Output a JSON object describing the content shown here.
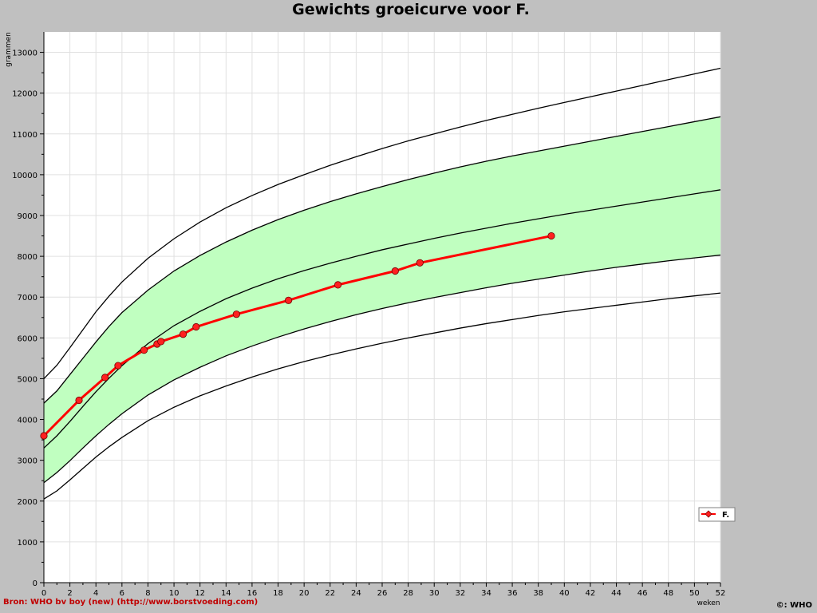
{
  "chart_data": {
    "type": "line",
    "title": "Gewichts groeicurve voor F.",
    "xlabel": "weken",
    "ylabel": "grammen",
    "xlim": [
      0,
      52
    ],
    "ylim": [
      0,
      13500
    ],
    "x_ticks": [
      0,
      2,
      4,
      6,
      8,
      10,
      12,
      14,
      16,
      18,
      20,
      22,
      24,
      26,
      28,
      30,
      32,
      34,
      36,
      38,
      40,
      42,
      44,
      46,
      48,
      50,
      52
    ],
    "y_ticks": [
      0,
      1000,
      2000,
      3000,
      4000,
      5000,
      6000,
      7000,
      8000,
      9000,
      10000,
      11000,
      12000,
      13000
    ],
    "grid": true,
    "reference_x": [
      0,
      1,
      2,
      3,
      4,
      5,
      6,
      8,
      10,
      12,
      14,
      16,
      18,
      20,
      22,
      24,
      26,
      28,
      30,
      32,
      34,
      36,
      38,
      40,
      42,
      44,
      46,
      48,
      50,
      52
    ],
    "reference_curves": [
      {
        "values": [
          2050,
          2250,
          2520,
          2800,
          3080,
          3330,
          3560,
          3970,
          4300,
          4580,
          4820,
          5040,
          5240,
          5420,
          5580,
          5730,
          5870,
          6000,
          6120,
          6240,
          6350,
          6450,
          6550,
          6640,
          6720,
          6800,
          6880,
          6960,
          7030,
          7100
        ]
      },
      {
        "values": [
          2450,
          2700,
          2990,
          3300,
          3600,
          3880,
          4140,
          4600,
          4970,
          5280,
          5560,
          5800,
          6020,
          6220,
          6400,
          6570,
          6720,
          6860,
          6990,
          7110,
          7230,
          7340,
          7440,
          7540,
          7640,
          7730,
          7810,
          7890,
          7960,
          8030
        ]
      },
      {
        "values": [
          3300,
          3600,
          3950,
          4320,
          4680,
          5010,
          5320,
          5860,
          6300,
          6650,
          6960,
          7220,
          7450,
          7650,
          7830,
          8000,
          8160,
          8300,
          8440,
          8570,
          8690,
          8810,
          8920,
          9030,
          9130,
          9230,
          9330,
          9430,
          9530,
          9630
        ]
      },
      {
        "values": [
          4400,
          4700,
          5100,
          5500,
          5900,
          6280,
          6620,
          7170,
          7640,
          8020,
          8350,
          8640,
          8900,
          9130,
          9340,
          9530,
          9710,
          9880,
          10040,
          10190,
          10330,
          10460,
          10580,
          10700,
          10820,
          10940,
          11060,
          11180,
          11300,
          11420
        ]
      },
      {
        "values": [
          5000,
          5330,
          5760,
          6200,
          6640,
          7020,
          7370,
          7950,
          8430,
          8840,
          9190,
          9490,
          9760,
          10000,
          10230,
          10440,
          10640,
          10830,
          11000,
          11170,
          11330,
          11480,
          11630,
          11770,
          11910,
          12050,
          12190,
          12330,
          12470,
          12610
        ]
      }
    ],
    "band_between_curves": [
      1,
      3
    ],
    "series": [
      {
        "name": "F.",
        "x": [
          0,
          2.7,
          4.7,
          5.7,
          7.7,
          8.7,
          9.0,
          10.7,
          11.7,
          14.8,
          18.8,
          22.6,
          27.0,
          28.9,
          39.0
        ],
        "values": [
          3600,
          4470,
          5030,
          5320,
          5700,
          5850,
          5910,
          6090,
          6270,
          6580,
          6920,
          7300,
          7640,
          7840,
          8500
        ]
      }
    ],
    "legend_position": "right",
    "colors": {
      "band": "#c0ffc0",
      "series": "#ff0000",
      "marker_fill": "#ff2020",
      "grid": "#e0e0e0",
      "reference": "#000000",
      "source_text": "#c00000"
    }
  },
  "footer": {
    "source": "Bron: WHO bv boy (new) (http://www.borstvoeding.com)",
    "copyright": "©: WHO"
  }
}
